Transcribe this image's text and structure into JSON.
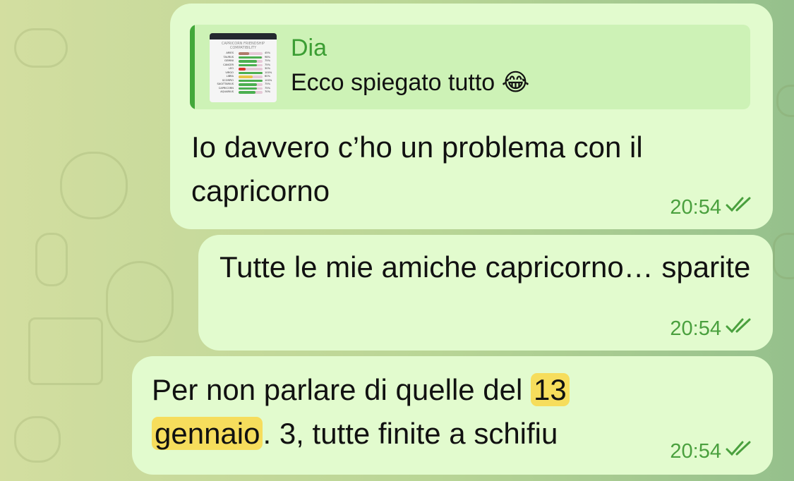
{
  "messages": [
    {
      "reply": {
        "author": "Dia",
        "text": "Ecco spiegato tutto 😂",
        "thumbnail": {
          "title": "CAPRICORN FRIENDSHIP COMPATIBILITY",
          "rows": [
            {
              "sign": "ARIES",
              "pct": "45%",
              "value": 45,
              "color": "#b07a6a"
            },
            {
              "sign": "TAURUS",
              "pct": "98%",
              "value": 98,
              "color": "#4caf50"
            },
            {
              "sign": "GEMINI",
              "pct": "75%",
              "value": 75,
              "color": "#4caf50"
            },
            {
              "sign": "CANCER",
              "pct": "75%",
              "value": 75,
              "color": "#4caf50"
            },
            {
              "sign": "LEO",
              "pct": "30%",
              "value": 30,
              "color": "#d9342b"
            },
            {
              "sign": "VIRGO",
              "pct": "100%",
              "value": 100,
              "color": "#4caf50"
            },
            {
              "sign": "LIBRA",
              "pct": "60%",
              "value": 60,
              "color": "#e8c547"
            },
            {
              "sign": "SCORPIO",
              "pct": "100%",
              "value": 100,
              "color": "#4caf50"
            },
            {
              "sign": "SAGITTARIUS",
              "pct": "75%",
              "value": 75,
              "color": "#4caf50"
            },
            {
              "sign": "CAPRICORN",
              "pct": "75%",
              "value": 75,
              "color": "#4caf50"
            },
            {
              "sign": "AQUARIUS",
              "pct": "70%",
              "value": 70,
              "color": "#4caf50"
            }
          ]
        }
      },
      "text": "Io davvero c’ho un problema con il capricorno",
      "time": "20:54"
    },
    {
      "text": "Tutte le mie amiche capricorno… sparite",
      "time": "20:54"
    },
    {
      "text_part1": "Per non parlare di quelle del ",
      "highlight_1": "13",
      "highlight_2": "gennaio",
      "text_part2": ". 3, tutte finite a schifiu",
      "time": "20:54"
    }
  ],
  "colors": {
    "bubble": "#e2fbce",
    "accent": "#4aa03e",
    "highlight": "#f6dd5c"
  },
  "icons": {
    "read_receipt": "double-check-icon"
  }
}
